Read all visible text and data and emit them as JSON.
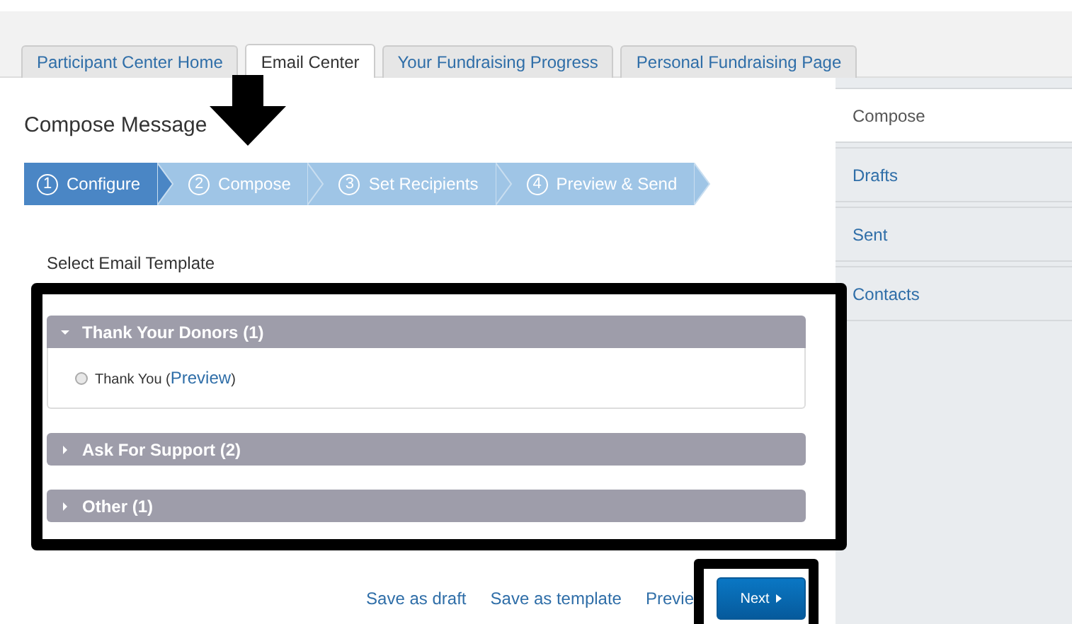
{
  "tabs": [
    {
      "label": "Participant Center Home",
      "selected": false
    },
    {
      "label": "Email Center",
      "selected": true
    },
    {
      "label": "Your Fundraising Progress",
      "selected": false
    },
    {
      "label": "Personal Fundraising Page",
      "selected": false
    }
  ],
  "title": "Compose Message",
  "steps": [
    {
      "number": "1",
      "label": "Configure",
      "selected": true
    },
    {
      "number": "2",
      "label": "Compose",
      "selected": false
    },
    {
      "number": "3",
      "label": "Set Recipients",
      "selected": false
    },
    {
      "number": "4",
      "label": "Preview & Send",
      "selected": false
    }
  ],
  "section_label": "Select Email Template",
  "groups": [
    {
      "title": "Thank Your Donors (1)",
      "expanded": true,
      "templates": [
        {
          "prefix": "Thank You (",
          "link": "Preview",
          "suffix": ")",
          "selected": false
        }
      ]
    },
    {
      "title": "Ask For Support (2)",
      "expanded": false
    },
    {
      "title": "Other (1)",
      "expanded": false
    }
  ],
  "actions": [
    "Save as draft",
    "Save as template",
    "Previe"
  ],
  "next_button": "Next",
  "sidebar": [
    {
      "label": "Compose",
      "selected": true
    },
    {
      "label": "Drafts",
      "selected": false
    },
    {
      "label": "Sent",
      "selected": false
    },
    {
      "label": "Contacts",
      "selected": false
    }
  ]
}
